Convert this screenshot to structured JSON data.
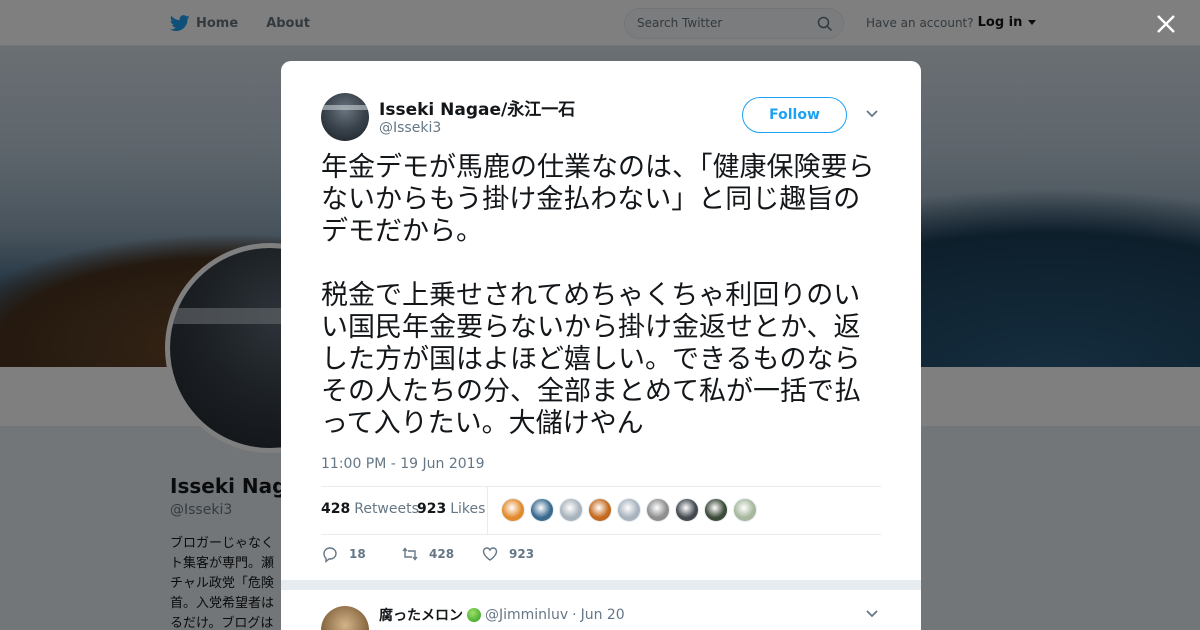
{
  "nav": {
    "home": "Home",
    "about": "About",
    "search_placeholder": "Search Twitter",
    "account_prompt": "Have an account?",
    "login": "Log in"
  },
  "profile": {
    "name": "Isseki Naga",
    "handle": "@Isseki3",
    "bio": "ブロガーじゃなく\nト集客が専門。瀬\nチャル政党「危険\n首。入党希望者は\nるだけ。ブログは"
  },
  "tweet": {
    "author_name": "Isseki Nagae/永江一石",
    "author_handle": "@Isseki3",
    "follow_label": "Follow",
    "text": "年金デモが馬鹿の仕業なのは、「健康保険要らないからもう掛け金払わない」と同じ趣旨のデモだから。\n\n税金で上乗せされてめちゃくちゃ利回りのいい国民年金要らないから掛け金返せとか、返した方が国はよほど嬉しい。できるものならその人たちの分、全部まとめて私が一括で払って入りたい。大儲けやん",
    "timestamp": "11:00 PM - 19 Jun 2019",
    "retweets_count": "428",
    "retweets_label": "Retweets",
    "likes_count": "923",
    "likes_label": "Likes",
    "reply_count": "18",
    "retweet_action_count": "428",
    "like_action_count": "923",
    "liker_colors": [
      "#e38b2c",
      "#3a6b8f",
      "#a8b3bd",
      "#c46a1e",
      "#a8b3bd",
      "#8f8f8f",
      "#444a50",
      "#3d4a3a",
      "#a7b89e"
    ]
  },
  "reply": {
    "name": "腐ったメロン",
    "handle": "@Jimminluv",
    "date": "Jun 20"
  },
  "colors": {
    "brand": "#1da1f2",
    "text": "#14171a",
    "muted": "#657786"
  }
}
